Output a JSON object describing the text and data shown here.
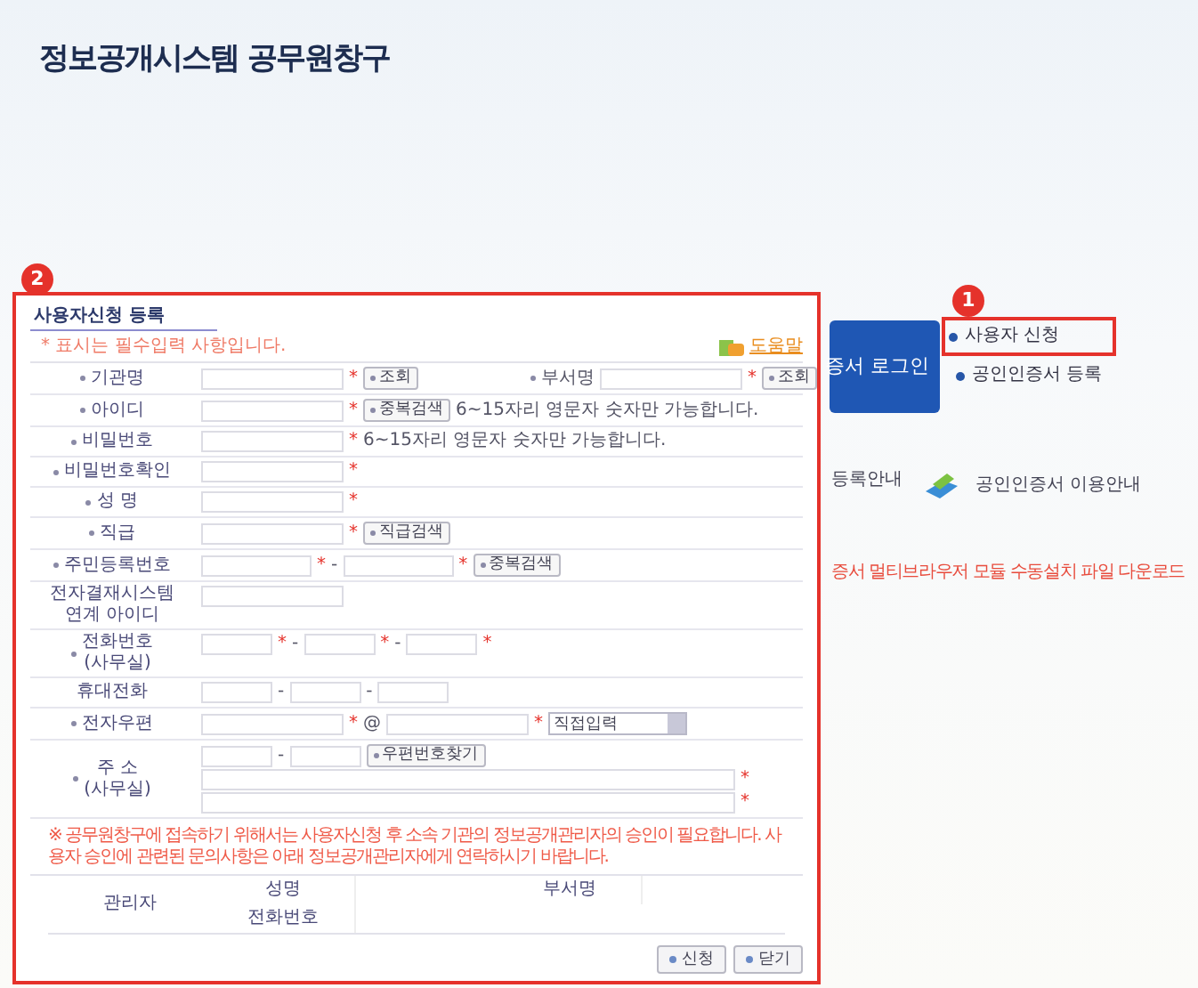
{
  "header": {
    "title": "정보공개시스템 공무원창구"
  },
  "login": {
    "button": "증서 로그인",
    "links": [
      {
        "label": "사용자 신청",
        "highlighted": true
      },
      {
        "label": "공인인증서 등록",
        "highlighted": false
      }
    ],
    "guides": [
      {
        "label": "등록안내",
        "icon": false
      },
      {
        "label": "공인인증서 이용안내",
        "icon": true
      }
    ],
    "notice": "증서 멀티브라우저 모듈 수동설치 파일 다운로드"
  },
  "callouts": [
    "1",
    "2"
  ],
  "popup": {
    "title": "사용자신청 등록",
    "required_note": "* 표시는 필수입력 사항입니다.",
    "help": "도움말",
    "rows": [
      {
        "label": "기관명",
        "bullet": true,
        "lines": [
          [
            {
              "kind": "input",
              "mark": "*"
            },
            {
              "kind": "button",
              "label": "조회"
            },
            {
              "kind": "label",
              "text": "부서명"
            },
            {
              "kind": "input",
              "mark": "*"
            },
            {
              "kind": "button",
              "label": "조회"
            }
          ]
        ]
      },
      {
        "label": "아이디",
        "bullet": true,
        "lines": [
          [
            {
              "kind": "input",
              "mark": "*"
            },
            {
              "kind": "button",
              "label": "중복검색"
            },
            {
              "kind": "text",
              "text": "6~15자리 영문자 숫자만 가능합니다."
            }
          ]
        ]
      },
      {
        "label": "비밀번호",
        "bullet": true,
        "lines": [
          [
            {
              "kind": "input",
              "mark": "*"
            },
            {
              "kind": "text",
              "text": "6~15자리 영문자 숫자만 가능합니다."
            }
          ]
        ]
      },
      {
        "label": "비밀번호확인",
        "bullet": true,
        "lines": [
          [
            {
              "kind": "input",
              "mark": "*"
            }
          ]
        ]
      },
      {
        "label": "성 명",
        "bullet": true,
        "lines": [
          [
            {
              "kind": "input",
              "mark": "*"
            }
          ]
        ]
      },
      {
        "label": "직급",
        "bullet": true,
        "lines": [
          [
            {
              "kind": "input",
              "mark": "*"
            },
            {
              "kind": "button",
              "label": "직급검색"
            }
          ]
        ]
      },
      {
        "label": "주민등록번호",
        "bullet": true,
        "lines": [
          [
            {
              "kind": "short-input",
              "mark": "*"
            },
            {
              "kind": "separator",
              "text": "-"
            },
            {
              "kind": "short-input",
              "mark": "*"
            },
            {
              "kind": "button",
              "label": "중복검색"
            }
          ]
        ]
      },
      {
        "label": "전자결재시스템",
        "sublabel": "연계 아이디",
        "bullet": false,
        "lines": [
          [
            {
              "kind": "input"
            }
          ]
        ]
      },
      {
        "label": "전화번호",
        "sublabel": "(사무실)",
        "bullet": true,
        "lines": [
          [
            {
              "kind": "tiny-input",
              "mark": "*"
            },
            {
              "kind": "separator",
              "text": "-"
            },
            {
              "kind": "tiny-input",
              "mark": "*"
            },
            {
              "kind": "separator",
              "text": "-"
            },
            {
              "kind": "tiny-input",
              "mark": "*"
            }
          ]
        ]
      },
      {
        "label": "휴대전화",
        "bullet": false,
        "lines": [
          [
            {
              "kind": "tiny-input"
            },
            {
              "kind": "separator",
              "text": "-"
            },
            {
              "kind": "tiny-input"
            },
            {
              "kind": "separator",
              "text": "-"
            },
            {
              "kind": "tiny-input"
            }
          ]
        ]
      },
      {
        "label": "전자우편",
        "bullet": true,
        "lines": [
          [
            {
              "kind": "input",
              "mark": "*"
            },
            {
              "kind": "separator",
              "text": "@"
            },
            {
              "kind": "input",
              "mark": "*"
            },
            {
              "kind": "select",
              "value": "직접입력"
            }
          ]
        ]
      },
      {
        "label": "주 소",
        "sublabel": "(사무실)",
        "bullet": true,
        "lines": [
          [
            {
              "kind": "tiny-input"
            },
            {
              "kind": "separator",
              "text": "-"
            },
            {
              "kind": "tiny-input"
            },
            {
              "kind": "button",
              "label": "우편번호찾기"
            }
          ],
          [
            {
              "kind": "wide-input",
              "mark": "*"
            }
          ],
          [
            {
              "kind": "wide-input",
              "mark": "*"
            }
          ]
        ]
      }
    ],
    "notice": "※ 공무원창구에 접속하기 위해서는 사용자신청 후 소속 기관의 정보공개관리자의 승인이 필요합니다. 사용자 승인에 관련된 문의사항은 아래 정보공개관리자에게 연락하시기 바랍니다.",
    "manager": {
      "label": "관리자",
      "fields": [
        "성명",
        "부서명",
        "전화번호"
      ]
    },
    "buttons": [
      "신청",
      "닫기"
    ]
  }
}
